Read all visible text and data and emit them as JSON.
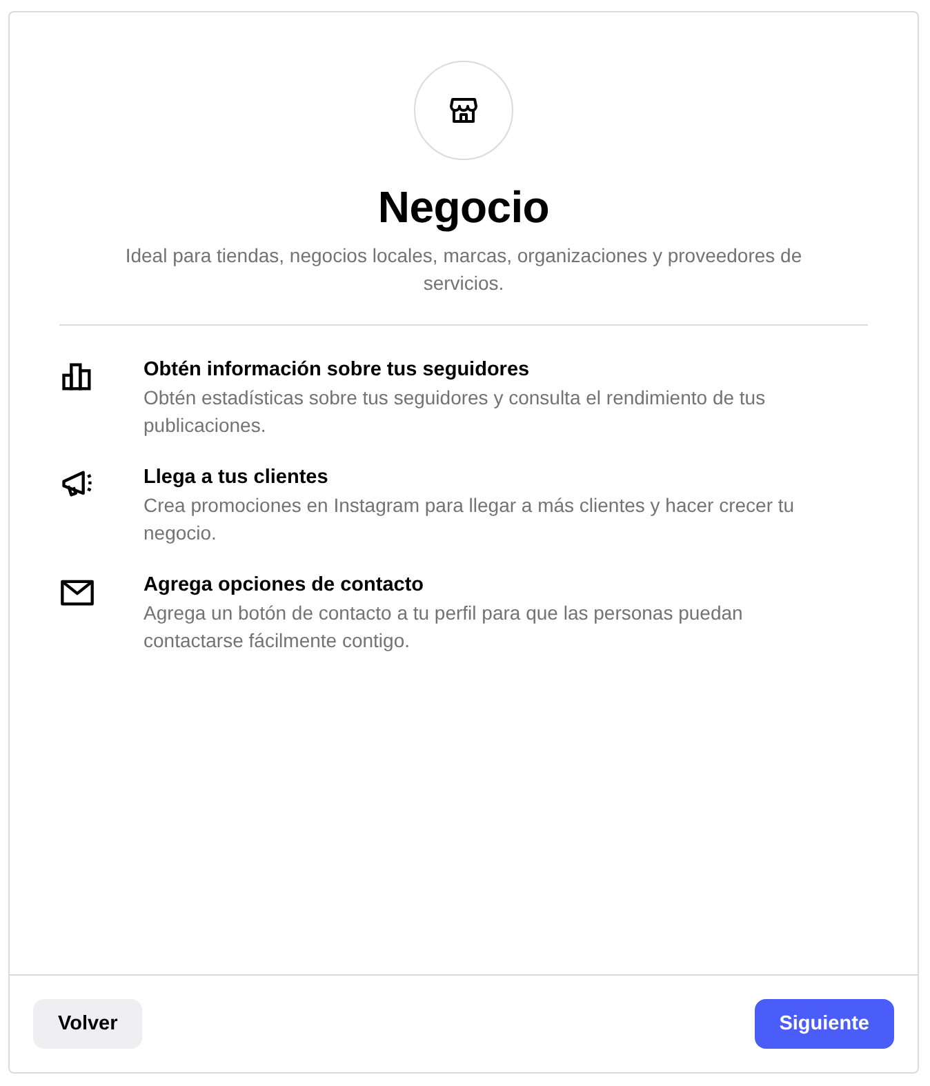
{
  "header": {
    "title": "Negocio",
    "subtitle": "Ideal para tiendas, negocios locales, marcas, organizaciones y proveedores de servicios."
  },
  "features": [
    {
      "title": "Obtén información sobre tus seguidores",
      "description": "Obtén estadísticas sobre tus seguidores y consulta el rendimiento de tus publicaciones."
    },
    {
      "title": "Llega a tus clientes",
      "description": "Crea promociones en Instagram para llegar a más clientes y hacer crecer tu negocio."
    },
    {
      "title": "Agrega opciones de contacto",
      "description": "Agrega un botón de contacto a tu perfil para que las personas puedan contactarse fácilmente contigo."
    }
  ],
  "buttons": [
    {
      "label": "Volver",
      "kind": "secondary"
    },
    {
      "label": "Siguiente",
      "kind": "primary"
    }
  ]
}
